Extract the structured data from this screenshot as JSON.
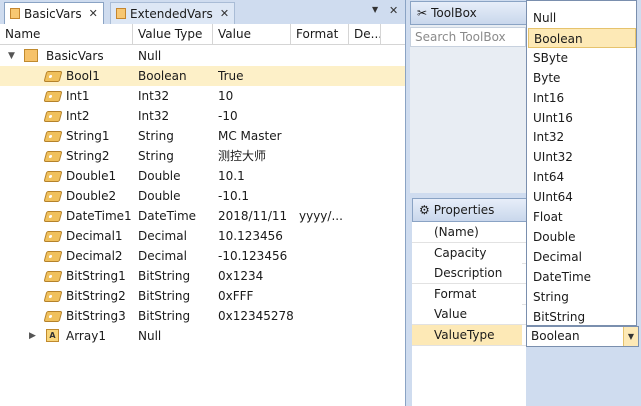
{
  "tabs": [
    {
      "label": "BasicVars",
      "close": "✕"
    },
    {
      "label": "ExtendedVars",
      "close": "✕"
    }
  ],
  "tabstrip_icons": {
    "dropdown": "▼",
    "close": "✕"
  },
  "columns": [
    "Name",
    "Value Type",
    "Value",
    "Format",
    "De..."
  ],
  "root": {
    "name": "BasicVars",
    "type": "Null",
    "expander": "▼"
  },
  "rows": [
    {
      "name": "Bool1",
      "type": "Boolean",
      "value": "True",
      "format": ""
    },
    {
      "name": "Int1",
      "type": "Int32",
      "value": "10",
      "format": ""
    },
    {
      "name": "Int2",
      "type": "Int32",
      "value": "-10",
      "format": ""
    },
    {
      "name": "String1",
      "type": "String",
      "value": "MC Master",
      "format": ""
    },
    {
      "name": "String2",
      "type": "String",
      "value": "测控大师",
      "format": ""
    },
    {
      "name": "Double1",
      "type": "Double",
      "value": "10.1",
      "format": ""
    },
    {
      "name": "Double2",
      "type": "Double",
      "value": "-10.1",
      "format": ""
    },
    {
      "name": "DateTime1",
      "type": "DateTime",
      "value": "2018/11/11",
      "format": "yyyy/..."
    },
    {
      "name": "Decimal1",
      "type": "Decimal",
      "value": "10.123456",
      "format": ""
    },
    {
      "name": "Decimal2",
      "type": "Decimal",
      "value": "-10.123456",
      "format": ""
    },
    {
      "name": "BitString1",
      "type": "BitString",
      "value": "0x1234",
      "format": ""
    },
    {
      "name": "BitString2",
      "type": "BitString",
      "value": "0xFFF",
      "format": ""
    },
    {
      "name": "BitString3",
      "type": "BitString",
      "value": "0x12345278",
      "format": ""
    }
  ],
  "array_row": {
    "name": "Array1",
    "type": "Null",
    "expander": "▶",
    "icon_letter": "A"
  },
  "toolbox": {
    "title": "ToolBox",
    "search_placeholder": "Search ToolBox",
    "icon": "✂"
  },
  "properties": {
    "title": "Properties",
    "icon": "⚙",
    "rows": [
      {
        "label": "(Name)"
      },
      {
        "label": "Capacity"
      },
      {
        "label": "Description"
      },
      {
        "label": "Format"
      },
      {
        "label": "Value"
      },
      {
        "label": "ValueType",
        "value": "Boolean"
      }
    ]
  },
  "value_type_dropdown": {
    "options": [
      "Null",
      "Boolean",
      "SByte",
      "Byte",
      "Int16",
      "UInt16",
      "Int32",
      "UInt32",
      "Int64",
      "UInt64",
      "Float",
      "Double",
      "Decimal",
      "DateTime",
      "String",
      "BitString"
    ],
    "selected": "Boolean",
    "arrow": "▼"
  }
}
